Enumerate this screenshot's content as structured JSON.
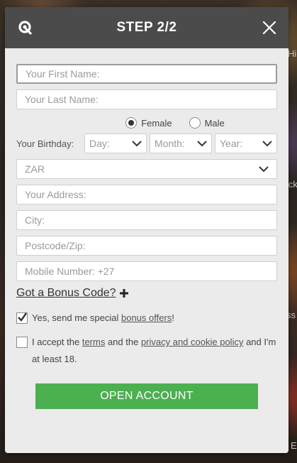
{
  "header": {
    "title": "STEP 2/2",
    "logo_icon": "brand-q-icon",
    "close_icon": "close-icon"
  },
  "form": {
    "first_name_placeholder": "Your First Name:",
    "last_name_placeholder": "Your Last Name:",
    "gender": {
      "female_label": "Female",
      "male_label": "Male",
      "selected": "Female"
    },
    "birthday": {
      "label": "Your Birthday:",
      "day": "Day:",
      "month": "Month:",
      "year": "Year:"
    },
    "currency": "ZAR",
    "address_placeholder": "Your Address:",
    "city_placeholder": "City:",
    "postcode_placeholder": "Postcode/Zip:",
    "mobile_placeholder": "Mobile Number: +27",
    "bonus_code_label": "Got a Bonus Code?",
    "offers": {
      "prefix": "Yes, send me special ",
      "link": "bonus offers",
      "suffix": "!",
      "checked": true
    },
    "terms": {
      "part1": "I accept the ",
      "terms_link": "terms",
      "part2": " and the ",
      "privacy_link": "privacy and cookie policy",
      "part3": " and I'm at least 18.",
      "checked": false
    },
    "submit_label": "OPEN ACCOUNT"
  },
  "background": {
    "text_1": "Hi",
    "text_2": "ick",
    "text_3": "ss",
    "text_4": "E"
  },
  "colors": {
    "header_bg": "#4b4b4b",
    "modal_bg": "#ebebeb",
    "button_green": "#4caf50"
  }
}
